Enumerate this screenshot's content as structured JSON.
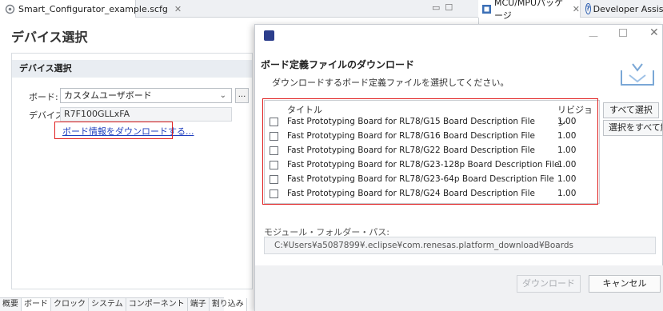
{
  "editor": {
    "tab_label": "Smart_Configurator_example.scfg",
    "page_title": "デバイス選択",
    "section_title": "デバイス選択",
    "board_label": "ボード:",
    "board_value": "カスタムユーザボード",
    "device_label": "デバイス:",
    "device_value": "R7F100GLLxFA",
    "download_link": "ボード情報をダウンロードする...",
    "more_button": "...",
    "bottom_tabs": [
      "概要",
      "ボード",
      "クロック",
      "システム",
      "コンポーネント",
      "端子",
      "割り込み"
    ]
  },
  "views": {
    "tabs": [
      {
        "label": "MCU/MPUパッケージ"
      },
      {
        "label": "Developer Assist Br"
      }
    ]
  },
  "dialog": {
    "title": "ボード定義ファイルのダウンロード",
    "subtitle": "ダウンロードするボード定義ファイルを選択してください。",
    "columns": {
      "title": "タイトル",
      "revision": "リビジョン"
    },
    "rows": [
      {
        "title": "Fast Prototyping Board for RL78/G15 Board Description File",
        "revision": "1.00",
        "checked": false
      },
      {
        "title": "Fast Prototyping Board for RL78/G16 Board Description File",
        "revision": "1.00",
        "checked": false
      },
      {
        "title": "Fast Prototyping Board for RL78/G22 Board Description File",
        "revision": "1.00",
        "checked": false
      },
      {
        "title": "Fast Prototyping Board for RL78/G23-128p Board Description File",
        "revision": "1.00",
        "checked": false
      },
      {
        "title": "Fast Prototyping Board for RL78/G23-64p Board Description File",
        "revision": "1.00",
        "checked": false
      },
      {
        "title": "Fast Prototyping Board for RL78/G24 Board Description File",
        "revision": "1.00",
        "checked": false
      }
    ],
    "select_all": "すべて選択",
    "deselect_all": "選択をすべて解除",
    "module_label": "モジュール・フォルダー・パス:",
    "module_path": "C:¥Users¥a5087899¥.eclipse¥com.renesas.platform_download¥Boards",
    "download_button": "ダウンロード",
    "cancel_button": "キャンセル"
  },
  "colors": {
    "highlight": "#e02020",
    "link": "#1f3fbf",
    "section_bg": "#e9edf2"
  },
  "icons": [
    "config-file-icon",
    "package-icon",
    "help-icon",
    "dialog-app-icon",
    "download-banner-icon"
  ]
}
